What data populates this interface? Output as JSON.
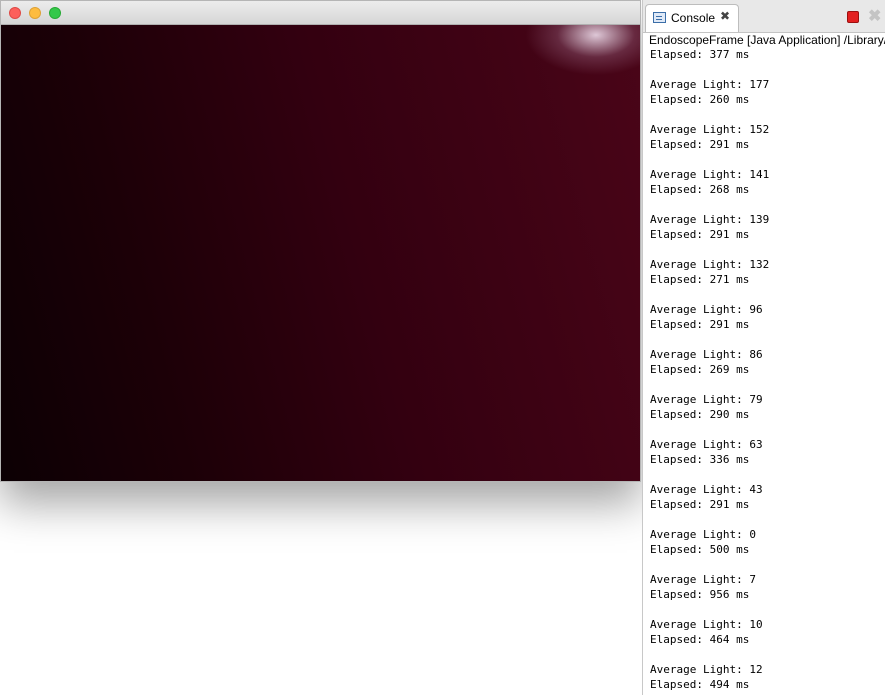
{
  "console": {
    "tab_label": "Console",
    "launch_label": "EndoscopeFrame [Java Application] /Library/",
    "first_line": "Elapsed: 377 ms",
    "entries": [
      {
        "light": "Average Light: 177",
        "elapsed": "Elapsed: 260 ms"
      },
      {
        "light": "Average Light: 152",
        "elapsed": "Elapsed: 291 ms"
      },
      {
        "light": "Average Light: 141",
        "elapsed": "Elapsed: 268 ms"
      },
      {
        "light": "Average Light: 139",
        "elapsed": "Elapsed: 291 ms"
      },
      {
        "light": "Average Light: 132",
        "elapsed": "Elapsed: 271 ms"
      },
      {
        "light": "Average Light: 96",
        "elapsed": "Elapsed: 291 ms"
      },
      {
        "light": "Average Light: 86",
        "elapsed": "Elapsed: 269 ms"
      },
      {
        "light": "Average Light: 79",
        "elapsed": "Elapsed: 290 ms"
      },
      {
        "light": "Average Light: 63",
        "elapsed": "Elapsed: 336 ms"
      },
      {
        "light": "Average Light: 43",
        "elapsed": "Elapsed: 291 ms"
      },
      {
        "light": "Average Light: 0",
        "elapsed": "Elapsed: 500 ms"
      },
      {
        "light": "Average Light: 7",
        "elapsed": "Elapsed: 956 ms"
      },
      {
        "light": "Average Light: 10",
        "elapsed": "Elapsed: 464 ms"
      },
      {
        "light": "Average Light: 12",
        "elapsed": "Elapsed: 494 ms"
      }
    ],
    "icons": {
      "tab": "console-icon",
      "close": "close-icon",
      "terminate": "terminate-icon",
      "remove_all": "remove-all-icon"
    }
  },
  "frame": {
    "colors": {
      "close": "#fc605c",
      "minimize": "#fdbc40",
      "maximize": "#34c84a"
    }
  }
}
